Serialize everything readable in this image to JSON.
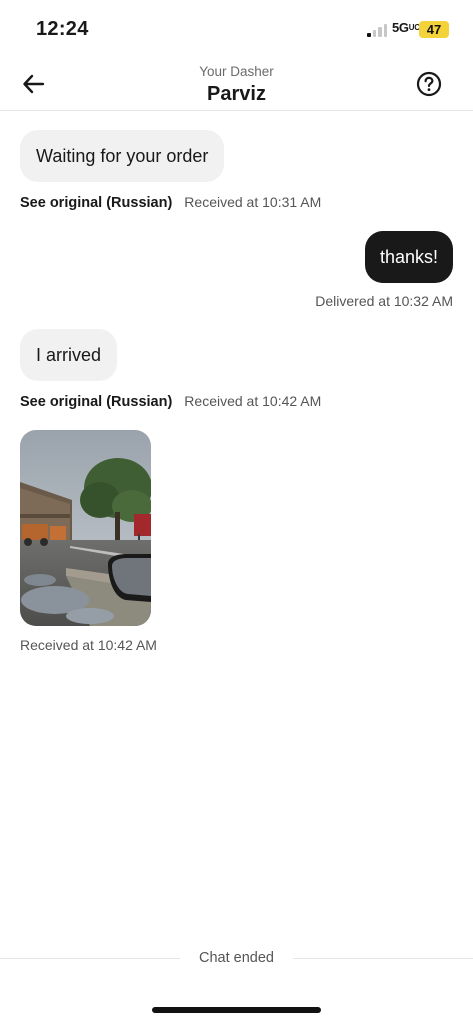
{
  "status_bar": {
    "time": "12:24",
    "network": "5G",
    "battery": "47"
  },
  "header": {
    "subtitle": "Your Dasher",
    "title": "Parviz"
  },
  "messages": [
    {
      "direction": "in",
      "text": "Waiting for your order",
      "see_original": "See original (Russian)",
      "timestamp": "Received at 10:31 AM"
    },
    {
      "direction": "out",
      "text": "thanks!",
      "timestamp": "Delivered at 10:32 AM"
    },
    {
      "direction": "in",
      "text": "I arrived",
      "see_original": "See original (Russian)",
      "timestamp": "Received at 10:42 AM"
    },
    {
      "direction": "in",
      "type": "photo",
      "timestamp": "Received at 10:42 AM"
    }
  ],
  "footer": {
    "chat_ended": "Chat ended"
  },
  "colors": {
    "incoming_bubble": "#f1f1f1",
    "outgoing_bubble": "#191919",
    "battery": "#f3d23a"
  }
}
